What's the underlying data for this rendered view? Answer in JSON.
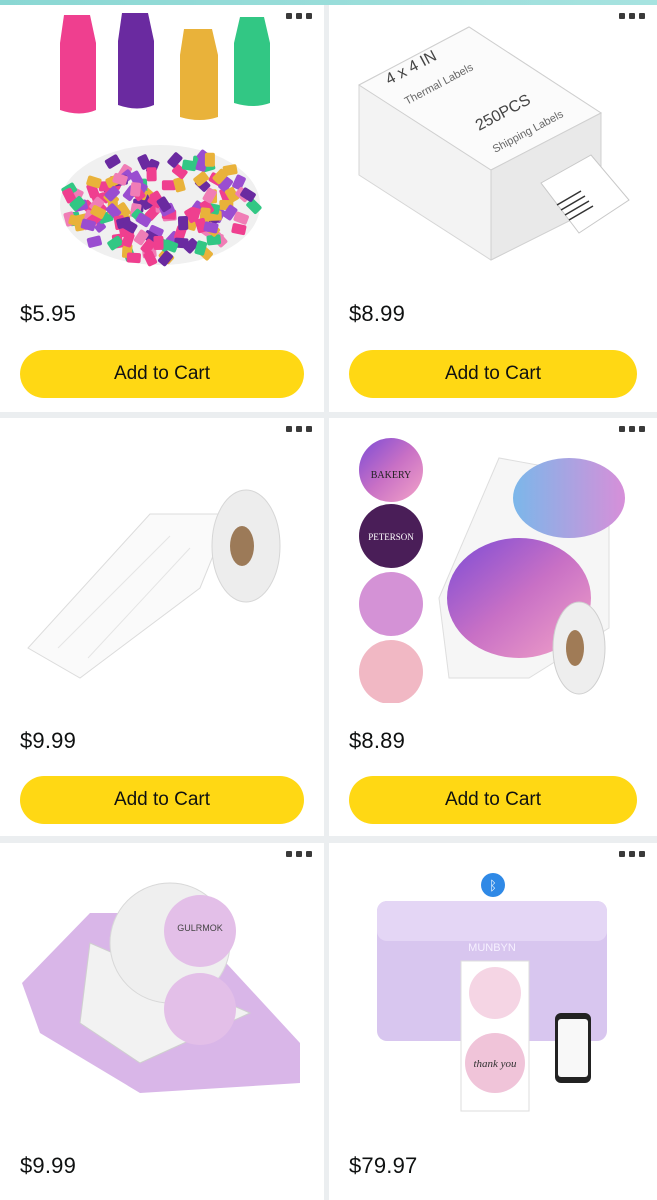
{
  "colors": {
    "button_bg": "#ffd814",
    "page_bg": "#ebeef0",
    "card_bg": "#ffffff",
    "top_accent": "#8ad7d3"
  },
  "products": [
    {
      "image": "eraser-caps",
      "image_text": {},
      "price": "$5.95",
      "button": "Add to Cart",
      "more_icon": "more-options-icon"
    },
    {
      "image": "thermal-label-stack",
      "image_text": {
        "line1": "4 x 4 IN",
        "line2": "Thermal Labels",
        "line3": "250PCS",
        "line4": "Shipping Labels"
      },
      "price": "$8.99",
      "button": "Add to Cart",
      "more_icon": "more-options-icon"
    },
    {
      "image": "white-label-roll",
      "image_text": {},
      "price": "$9.99",
      "button": "Add to Cart",
      "more_icon": "more-options-icon"
    },
    {
      "image": "glitter-circle-sticker-roll",
      "image_text": {
        "s1": "BAKERY",
        "s2": "PETERSON"
      },
      "price": "$8.89",
      "button": "Add to Cart",
      "more_icon": "more-options-icon"
    },
    {
      "image": "purple-label-holder",
      "image_text": {
        "brand": "GULRMOK"
      },
      "price": "$9.99",
      "more_icon": "more-options-icon"
    },
    {
      "image": "purple-label-printer",
      "image_text": {
        "brand": "MUNBYN",
        "label": "thank you"
      },
      "price": "$79.97",
      "more_icon": "more-options-icon"
    }
  ]
}
